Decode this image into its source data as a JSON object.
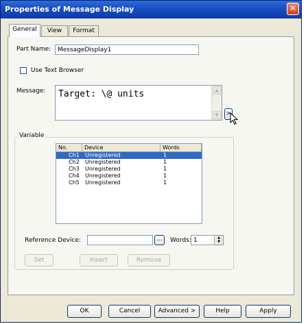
{
  "window": {
    "title": "Properties of Message Display",
    "close_glyph": "✕"
  },
  "tabs": [
    {
      "label": "General",
      "active": true
    },
    {
      "label": "View",
      "active": false
    },
    {
      "label": "Format",
      "active": false
    }
  ],
  "general": {
    "part_name_label": "Part Name:",
    "part_name_value": "MessageDisplay1",
    "use_text_browser_label": "Use Text Browser",
    "use_text_browser_checked": false,
    "message_label": "Message:",
    "message_value": "Target: \\@ units",
    "message_button_label": ">"
  },
  "variable": {
    "group_label": "Variable",
    "columns": [
      "No.",
      "Device",
      "Words"
    ],
    "rows": [
      {
        "no": "Ch1",
        "device": "Unregistered",
        "words": "1",
        "selected": true
      },
      {
        "no": "Ch2",
        "device": "Unregistered",
        "words": "1",
        "selected": false
      },
      {
        "no": "Ch3",
        "device": "Unregistered",
        "words": "1",
        "selected": false
      },
      {
        "no": "Ch4",
        "device": "Unregistered",
        "words": "1",
        "selected": false
      },
      {
        "no": "Ch5",
        "device": "Unregistered",
        "words": "1",
        "selected": false
      }
    ],
    "reference_device_label": "Reference Device:",
    "reference_device_value": "",
    "browse_label": "...",
    "words_label": "Words:",
    "words_value": "1",
    "set_label": "Set",
    "insert_label": "Insert",
    "remove_label": "Remove"
  },
  "footer": {
    "ok_label": "OK",
    "cancel_label": "Cancel",
    "advanced_label": "Advanced >",
    "help_label": "Help",
    "apply_label": "Apply"
  },
  "colors": {
    "title_bar": "#0c3aa8",
    "selection": "#316ac5",
    "dialog_bg": "#ece9d8"
  },
  "icons": [
    "close-icon",
    "checkbox-icon",
    "scroll-up-icon",
    "scroll-down-icon",
    "spin-up-icon",
    "spin-down-icon",
    "mouse-cursor-icon"
  ]
}
